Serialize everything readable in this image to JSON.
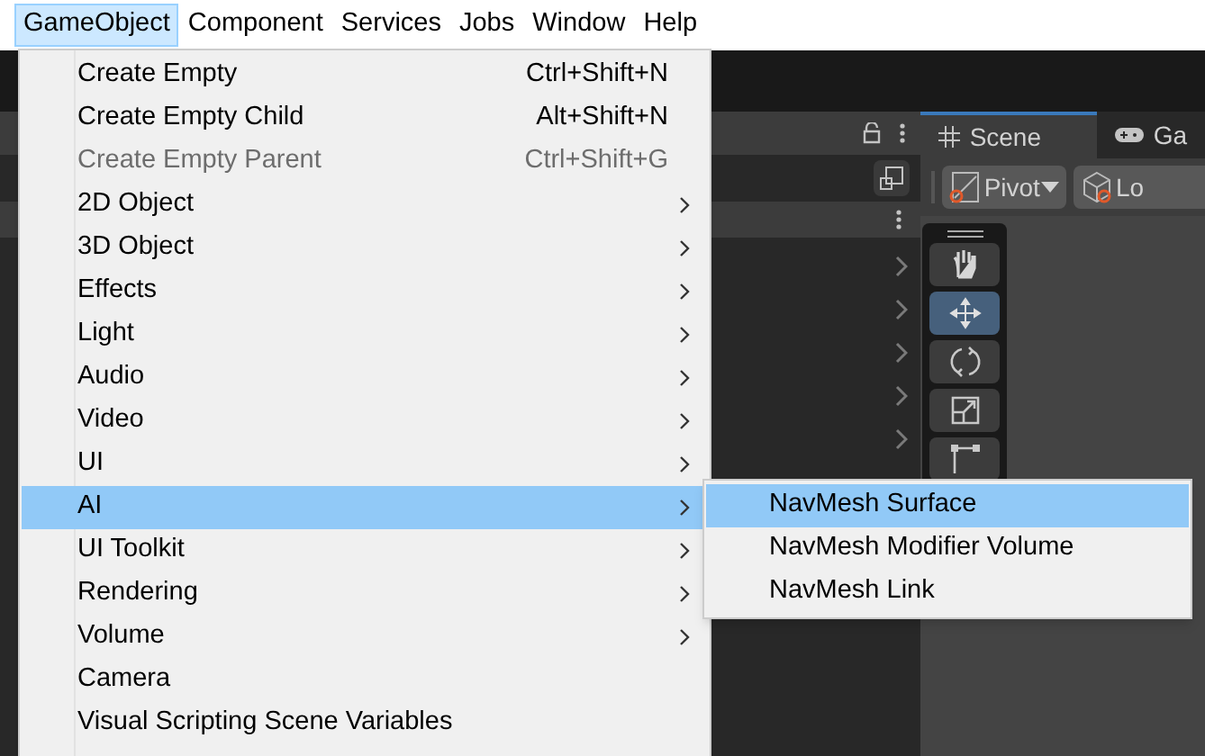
{
  "menu_bar": [
    {
      "label": "GameObject",
      "selected": true
    },
    {
      "label": "Component",
      "selected": false
    },
    {
      "label": "Services",
      "selected": false
    },
    {
      "label": "Jobs",
      "selected": false
    },
    {
      "label": "Window",
      "selected": false
    },
    {
      "label": "Help",
      "selected": false
    }
  ],
  "menu": [
    {
      "label": "Create Empty",
      "shortcut": "Ctrl+Shift+N",
      "disabled": false,
      "submenu": false,
      "selected": false
    },
    {
      "label": "Create Empty Child",
      "shortcut": "Alt+Shift+N",
      "disabled": false,
      "submenu": false,
      "selected": false
    },
    {
      "label": "Create Empty Parent",
      "shortcut": "Ctrl+Shift+G",
      "disabled": true,
      "submenu": false,
      "selected": false
    },
    {
      "label": "2D Object",
      "disabled": false,
      "submenu": true,
      "selected": false
    },
    {
      "label": "3D Object",
      "disabled": false,
      "submenu": true,
      "selected": false
    },
    {
      "label": "Effects",
      "disabled": false,
      "submenu": true,
      "selected": false
    },
    {
      "label": "Light",
      "disabled": false,
      "submenu": true,
      "selected": false
    },
    {
      "label": "Audio",
      "disabled": false,
      "submenu": true,
      "selected": false
    },
    {
      "label": "Video",
      "disabled": false,
      "submenu": true,
      "selected": false
    },
    {
      "label": "UI",
      "disabled": false,
      "submenu": true,
      "selected": false
    },
    {
      "label": "AI",
      "disabled": false,
      "submenu": true,
      "selected": true
    },
    {
      "label": "UI Toolkit",
      "disabled": false,
      "submenu": true,
      "selected": false
    },
    {
      "label": "Rendering",
      "disabled": false,
      "submenu": true,
      "selected": false
    },
    {
      "label": "Volume",
      "disabled": false,
      "submenu": true,
      "selected": false
    },
    {
      "label": "Camera",
      "disabled": false,
      "submenu": false,
      "selected": false
    },
    {
      "label": "Visual Scripting Scene Variables",
      "disabled": false,
      "submenu": false,
      "selected": false
    }
  ],
  "submenu": [
    {
      "label": "NavMesh Surface",
      "selected": true
    },
    {
      "label": "NavMesh Modifier Volume",
      "selected": false
    },
    {
      "label": "NavMesh Link",
      "selected": false
    }
  ],
  "scene_view": {
    "tabs": [
      {
        "label": "Scene",
        "kind": "scene",
        "selected": true
      },
      {
        "label": "Ga",
        "kind": "game",
        "selected": false
      }
    ],
    "pivot_label": "Pivot",
    "handle_label": "Lo",
    "tools": [
      {
        "kind": "hand",
        "selected": false
      },
      {
        "kind": "move",
        "selected": true
      },
      {
        "kind": "rotate",
        "selected": false
      },
      {
        "kind": "scale",
        "selected": false
      },
      {
        "kind": "rect",
        "selected": false
      }
    ]
  }
}
